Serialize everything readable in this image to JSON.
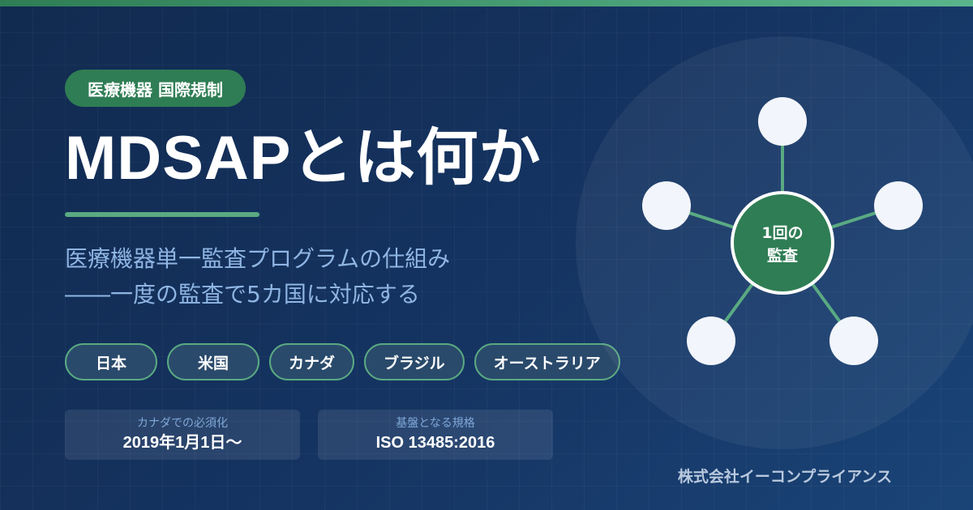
{
  "badge": "医療機器 国際規制",
  "title": "MDSAPとは何か",
  "subtitle_lines": [
    "医療機器単一監査プログラムの仕組み",
    "――一度の監査で5カ国に対応する"
  ],
  "countries": [
    "日本",
    "米国",
    "カナダ",
    "ブラジル",
    "オーストラリア"
  ],
  "info_cards": [
    {
      "label": "カナダでの必須化",
      "value": "2019年1月1日〜"
    },
    {
      "label": "基盤となる規格",
      "value": "ISO 13485:2016"
    }
  ],
  "diagram": {
    "center_line1": "1回の",
    "center_line2": "監査",
    "satellite_count": 5
  },
  "company": "株式会社イーコンプライアンス",
  "colors": {
    "accent_green": "#2f7d54",
    "outline_green": "#5aaa82",
    "background_navy": "#153462",
    "subtitle_blue": "#8fb5e3"
  }
}
